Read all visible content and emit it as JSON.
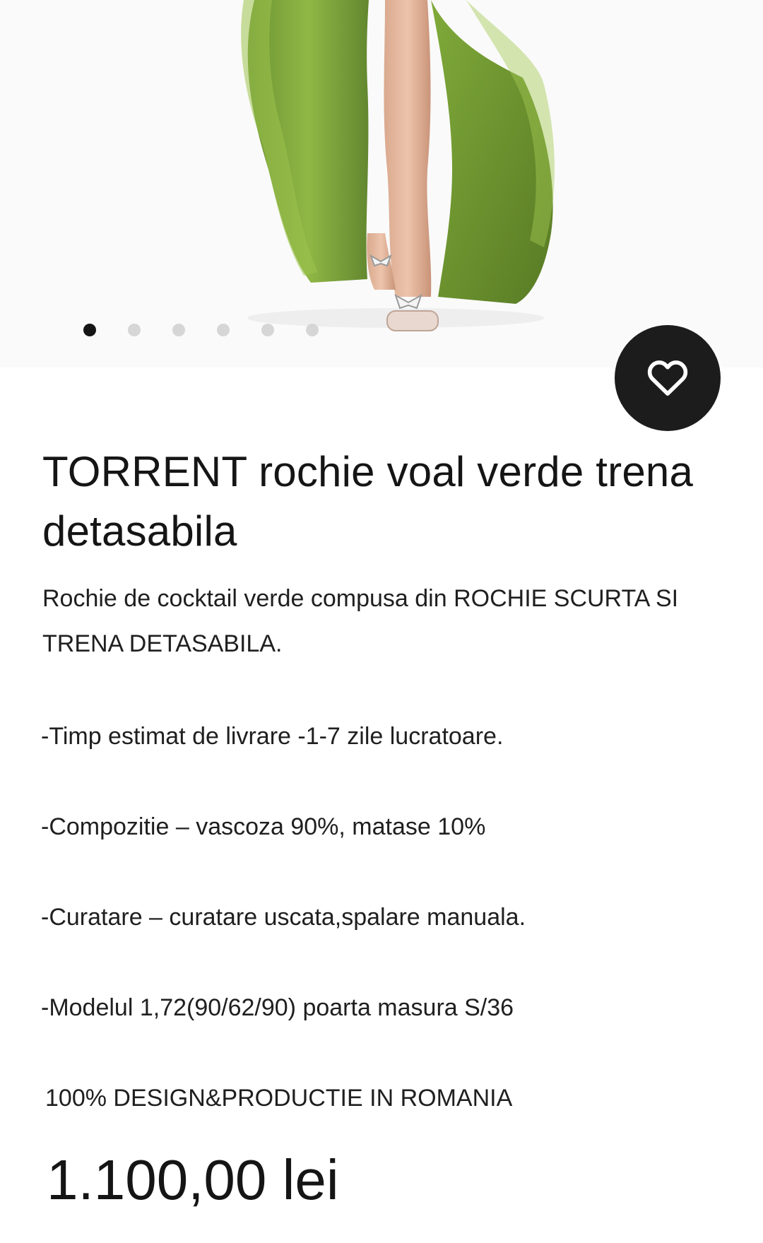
{
  "gallery": {
    "image_alt": "Model wearing green chiffon dress with detachable train and clear bow sandals",
    "slides_total": 6,
    "active_slide": 1
  },
  "favorite": {
    "icon": "heart-icon"
  },
  "product": {
    "title": "TORRENT rochie voal verde trena detasabila",
    "description": "Rochie de cocktail verde compusa din ROCHIE SCURTA SI TRENA DETASABILA.",
    "delivery": "-Timp estimat de livrare -1-7 zile lucratoare.",
    "composition": "-Compozitie – vascoza 90%, matase 10%",
    "care": "-Curatare – curatare uscata,spalare manuala.",
    "model": "-Modelul 1,72(90/62/90) poarta masura S/36",
    "origin": "100% DESIGN&PRODUCTIE IN ROMANIA",
    "price": "1.100,00 lei"
  },
  "colors": {
    "dress_green": "#6f9a2a",
    "dark_button": "#1c1c1c",
    "dot_inactive": "#d6d6d6",
    "dot_active": "#151515"
  }
}
